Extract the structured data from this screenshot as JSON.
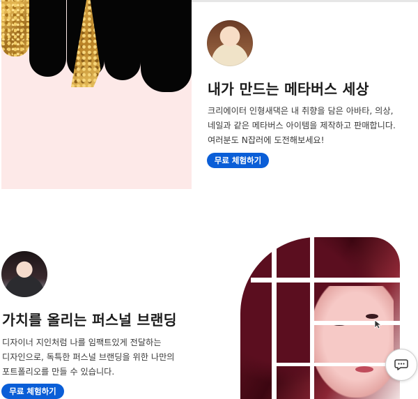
{
  "section1": {
    "title": "내가 만드는 메타버스 세상",
    "description": [
      "크리에이터 인형새댁은 내 취향을 담은 아바타, 의상,",
      "네일과 같은 메타버스 아이템을 제작하고 판매합니다.",
      "여러분도 N잡러에 도전해보세요!"
    ],
    "cta_label": "무료 체험하기"
  },
  "section2": {
    "title": "가치를 올리는 퍼스널 브랜딩",
    "description": [
      "디자이너 지인처럼 나를 임팩트있게 전달하는",
      "디자인으로, 독특한 퍼스널 브랜딩을 위한 나만의",
      "포트폴리오를 만들 수 있습니다."
    ],
    "cta_label": "무료 체험하기"
  },
  "icons": {
    "chat": "chat-bubble-icon"
  },
  "colors": {
    "accent": "#0a5ed7",
    "panel_pink": "#fde9e8"
  }
}
